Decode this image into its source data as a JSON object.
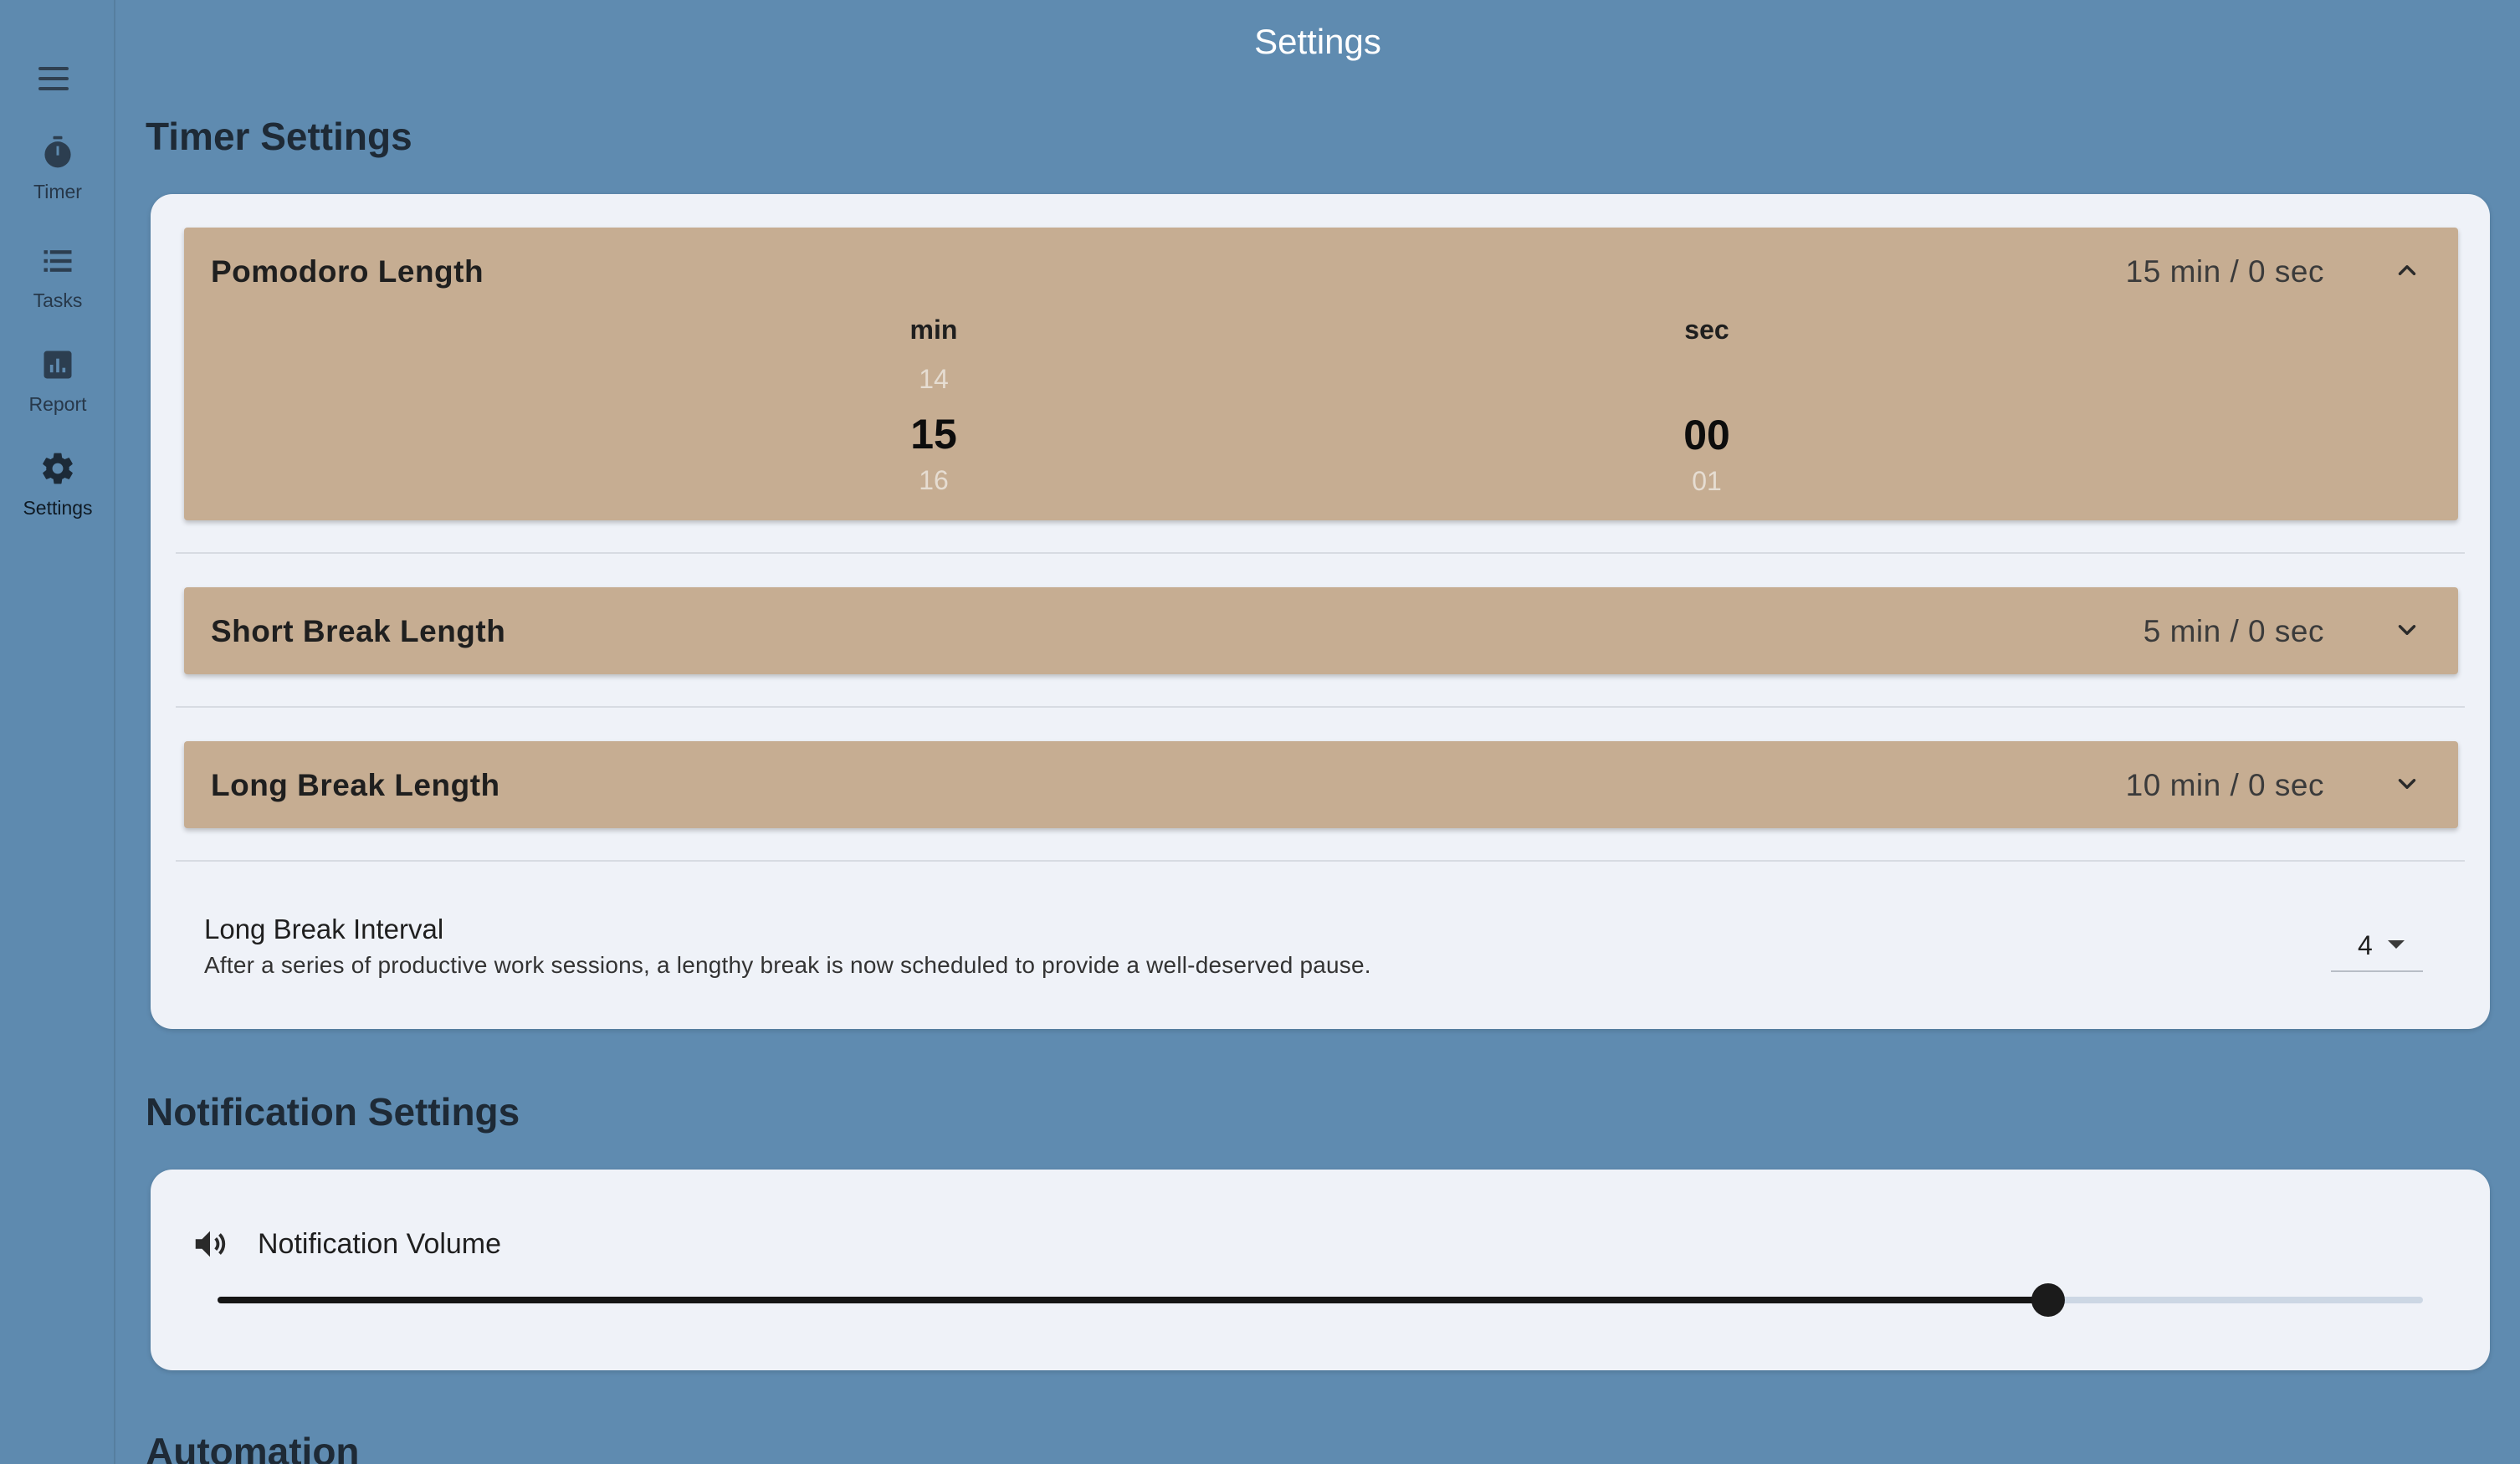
{
  "window": {
    "title": "Settings",
    "controls": [
      "close",
      "minimize",
      "zoom"
    ]
  },
  "sidebar": {
    "menu_icon": "hamburger-menu-icon",
    "items": [
      {
        "label": "Timer",
        "icon": "stopwatch-icon",
        "active": false
      },
      {
        "label": "Tasks",
        "icon": "list-icon",
        "active": false
      },
      {
        "label": "Report",
        "icon": "bar-chart-icon",
        "active": false
      },
      {
        "label": "Settings",
        "icon": "gear-icon",
        "active": true
      }
    ]
  },
  "timer_settings": {
    "section_title": "Timer Settings",
    "pomodoro": {
      "title": "Pomodoro Length",
      "value": "15 min / 0 sec",
      "expanded": true,
      "picker": {
        "min_header": "min",
        "sec_header": "sec",
        "min_prev": "14",
        "min_current": "15",
        "min_next": "16",
        "sec_prev": "",
        "sec_current": "00",
        "sec_next": "01"
      }
    },
    "short_break": {
      "title": "Short Break Length",
      "value": "5 min / 0 sec",
      "expanded": false
    },
    "long_break": {
      "title": "Long Break Length",
      "value": "10 min / 0 sec",
      "expanded": false
    },
    "long_break_interval": {
      "title": "Long Break Interval",
      "description": "After a series of productive work sessions, a lengthy break is now scheduled to provide a well-deserved pause.",
      "selected": "4"
    }
  },
  "notification_settings": {
    "section_title": "Notification Settings",
    "volume": {
      "label": "Notification Volume",
      "icon": "speaker-icon",
      "level": 0.83
    }
  },
  "automation": {
    "section_title": "Automation"
  },
  "colors": {
    "background": "#5f8bb0",
    "card": "#eff2f8",
    "panel": "#c6ad92",
    "slider_active": "#151515",
    "slider_inactive": "#ccd7e4"
  }
}
